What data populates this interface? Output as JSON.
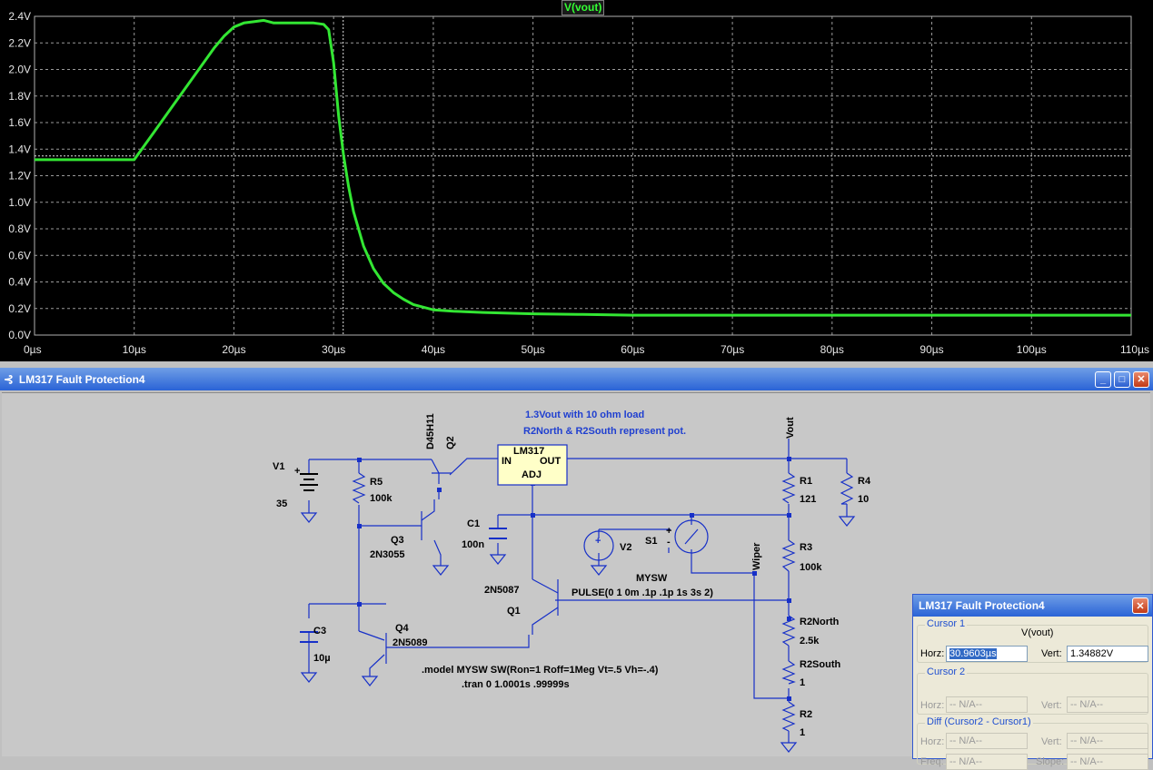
{
  "plot": {
    "trace_name": "V(vout)",
    "colors": {
      "background": "#000000",
      "trace": "#33e633",
      "grid": "#9a9a9a",
      "axis_text": "#e6e6e6"
    },
    "chart_data": {
      "type": "line",
      "title": "V(vout)",
      "xlabel": "",
      "ylabel": "",
      "xlim": [
        0,
        110
      ],
      "ylim": [
        0,
        2.4
      ],
      "x_ticks": [
        "0µs",
        "10µs",
        "20µs",
        "30µs",
        "40µs",
        "50µs",
        "60µs",
        "70µs",
        "80µs",
        "90µs",
        "100µs",
        "110µs"
      ],
      "y_ticks": [
        "0.0V",
        "0.2V",
        "0.4V",
        "0.6V",
        "0.8V",
        "1.0V",
        "1.2V",
        "1.4V",
        "1.6V",
        "1.8V",
        "2.0V",
        "2.2V",
        "2.4V"
      ],
      "grid": true,
      "cursor": {
        "x": 30.9603,
        "y": 1.34882
      },
      "series": [
        {
          "name": "V(vout)",
          "color": "#33e633",
          "x": [
            0,
            10,
            12,
            14,
            16,
            18,
            19,
            20,
            21,
            22,
            23,
            24,
            26,
            28,
            29,
            29.5,
            30,
            30.5,
            31,
            31.5,
            32,
            33,
            34,
            35,
            36,
            37,
            38,
            40,
            42,
            45,
            50,
            55,
            60,
            70,
            80,
            90,
            100,
            110
          ],
          "y": [
            1.32,
            1.32,
            1.53,
            1.74,
            1.95,
            2.16,
            2.25,
            2.32,
            2.35,
            2.36,
            2.37,
            2.35,
            2.35,
            2.35,
            2.34,
            2.3,
            2.05,
            1.65,
            1.35,
            1.12,
            0.93,
            0.67,
            0.5,
            0.39,
            0.32,
            0.27,
            0.23,
            0.19,
            0.18,
            0.17,
            0.16,
            0.155,
            0.15,
            0.15,
            0.15,
            0.15,
            0.15,
            0.15
          ]
        }
      ]
    }
  },
  "schematic_window": {
    "title": "LM317 Fault Protection4",
    "buttons": {
      "minimize": "_",
      "maximize": "□",
      "close": "✕"
    },
    "notes": {
      "line1": "1.3Vout with 10 ohm load",
      "line2": "R2North & R2South represent pot.",
      "model": ".model MYSW SW(Ron=1 Roff=1Meg Vt=.5 Vh=-.4)",
      "tran": ".tran 0 1.0001s .99999s",
      "pulse": "PULSE(0 1 0m .1p .1p 1s 3s 2)"
    },
    "components": {
      "v1": {
        "name": "V1",
        "value": "35"
      },
      "r5": {
        "name": "R5",
        "value": "100k"
      },
      "q2": {
        "name": "Q2",
        "model": "D45H11"
      },
      "q3": {
        "name": "Q3",
        "model": "2N3055"
      },
      "q4": {
        "name": "Q4",
        "model": "2N5089"
      },
      "q1": {
        "name": "Q1",
        "model": "2N5087"
      },
      "c1": {
        "name": "C1",
        "value": "100n"
      },
      "c3": {
        "name": "C3",
        "value": "10µ"
      },
      "lm317": {
        "name": "LM317",
        "in": "IN",
        "out": "OUT",
        "adj": "ADJ"
      },
      "v2": {
        "name": "V2"
      },
      "s1": {
        "name": "S1",
        "model": "MYSW"
      },
      "r1": {
        "name": "R1",
        "value": "121"
      },
      "r4": {
        "name": "R4",
        "value": "10"
      },
      "r3": {
        "name": "R3",
        "value": "100k"
      },
      "r2north": {
        "name": "R2North",
        "value": "2.5k"
      },
      "r2south": {
        "name": "R2South",
        "value": "1"
      },
      "r2": {
        "name": "R2",
        "value": "1"
      },
      "wiper": {
        "name": "Wiper"
      },
      "vout": {
        "name": "Vout"
      }
    },
    "colors": {
      "wire": "#1730c8",
      "note": "#1f3fd0",
      "background": "#c8c8c8"
    }
  },
  "cursor_window": {
    "title": "LM317 Fault Protection4",
    "close": "✕",
    "cursor1": {
      "title": "Cursor 1",
      "trace": "V(vout)",
      "horz_label": "Horz:",
      "horz_value": "30.9603µs",
      "vert_label": "Vert:",
      "vert_value": "1.34882V"
    },
    "cursor2": {
      "title": "Cursor 2",
      "horz_label": "Horz:",
      "horz_value": "-- N/A--",
      "vert_label": "Vert:",
      "vert_value": "-- N/A--"
    },
    "diff": {
      "title": "Diff (Cursor2 - Cursor1)",
      "horz_label": "Horz:",
      "horz_value": "-- N/A--",
      "vert_label": "Vert:",
      "vert_value": "-- N/A--",
      "freq_label": "Freq:",
      "freq_value": "-- N/A--",
      "slope_label": "Slope:",
      "slope_value": "-- N/A--"
    }
  }
}
